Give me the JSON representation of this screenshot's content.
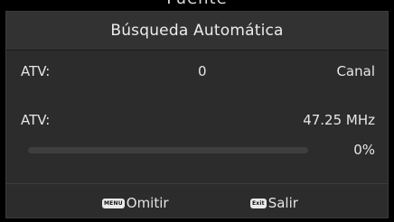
{
  "screen": {
    "top_title_fragment": "Fuente"
  },
  "dialog": {
    "title": "Búsqueda Automática",
    "rows": [
      {
        "label": "ATV:",
        "value": "0",
        "right": "Canal"
      },
      {
        "label": "ATV:",
        "value": "",
        "right": "47.25 MHz"
      }
    ],
    "progress": {
      "value": 0,
      "label": "0%"
    }
  },
  "footer": {
    "menu": {
      "icon": "menu-key-icon",
      "key_text": "MENU",
      "label": "Omitir"
    },
    "exit": {
      "icon": "exit-key-icon",
      "key_text": "Exit",
      "label": "Salir"
    }
  },
  "colors": {
    "background": "#000000",
    "dialog": "#2c2c2c",
    "header": "#323232",
    "text": "#e6e6e6",
    "progress_track": "#3e3e3e"
  }
}
